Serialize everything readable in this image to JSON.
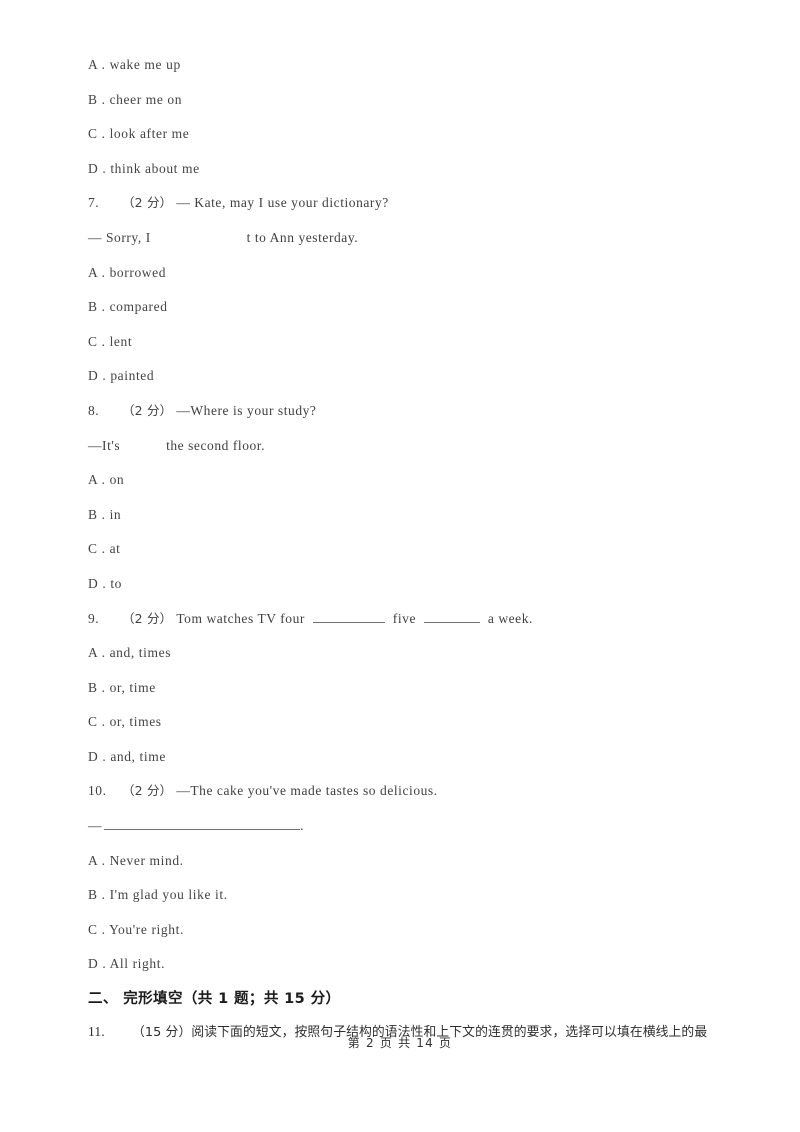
{
  "document": {
    "page_background": "#ffffff",
    "text_color": "#404040"
  },
  "questions": [
    {
      "id": "q6-options-continued",
      "options": [
        {
          "letter": "A",
          "sep": ".",
          "text": "wake me up"
        },
        {
          "letter": "B",
          "sep": ".",
          "text": "cheer me on"
        },
        {
          "letter": "C",
          "sep": ".",
          "text": "look after me"
        },
        {
          "letter": "D",
          "sep": ".",
          "text": "think about me"
        }
      ]
    },
    {
      "id": "q7",
      "number": "7.",
      "score": "（2 分）",
      "stem": "— Kate, may I use your dictionary?",
      "stem2_before": "— Sorry, I",
      "stem2_after": "t to Ann yesterday.",
      "options": [
        {
          "letter": "A",
          "sep": ".",
          "text": "borrowed"
        },
        {
          "letter": "B",
          "sep": ".",
          "text": "compared"
        },
        {
          "letter": "C",
          "sep": ".",
          "text": "lent"
        },
        {
          "letter": "D",
          "sep": ".",
          "text": "painted"
        }
      ]
    },
    {
      "id": "q8",
      "number": "8.",
      "score": "（2 分）",
      "stem": "—Where is your study?",
      "stem2_before": "—It's",
      "stem2_after": "the second floor.",
      "options": [
        {
          "letter": "A",
          "sep": ".",
          "text": "on"
        },
        {
          "letter": "B",
          "sep": ".",
          "text": "in"
        },
        {
          "letter": "C",
          "sep": ".",
          "text": "at"
        },
        {
          "letter": "D",
          "sep": ".",
          "text": "to"
        }
      ]
    },
    {
      "id": "q9",
      "number": "9.",
      "score": "（2 分）",
      "stem_part1": "Tom watches TV four",
      "stem_part2": "five",
      "stem_part3": "a week.",
      "options": [
        {
          "letter": "A",
          "sep": ".",
          "text": "and, times"
        },
        {
          "letter": "B",
          "sep": ".",
          "text": "or, time"
        },
        {
          "letter": "C",
          "sep": ".",
          "text": "or, times"
        },
        {
          "letter": "D",
          "sep": ".",
          "text": "and, time"
        }
      ]
    },
    {
      "id": "q10",
      "number": "10.",
      "score": "（2 分）",
      "stem": "—The cake you've made tastes so delicious.",
      "stem2_dash": "—",
      "stem2_after": ".",
      "options": [
        {
          "letter": "A",
          "sep": ".",
          "text": "Never mind."
        },
        {
          "letter": "B",
          "sep": ".",
          "text": "I'm glad you like it."
        },
        {
          "letter": "C",
          "sep": ".",
          "text": "You're right."
        },
        {
          "letter": "D",
          "sep": ".",
          "text": "All right."
        }
      ]
    }
  ],
  "section": {
    "heading": "二、 完形填空（共 1 题；共 15 分）"
  },
  "cloze": {
    "number": "11.",
    "score": "（15 分）",
    "text": "阅读下面的短文，按照句子结构的语法性和上下文的连贯的要求，选择可以填在横线上的最"
  },
  "footer": {
    "text": "第 2 页 共 14 页"
  }
}
